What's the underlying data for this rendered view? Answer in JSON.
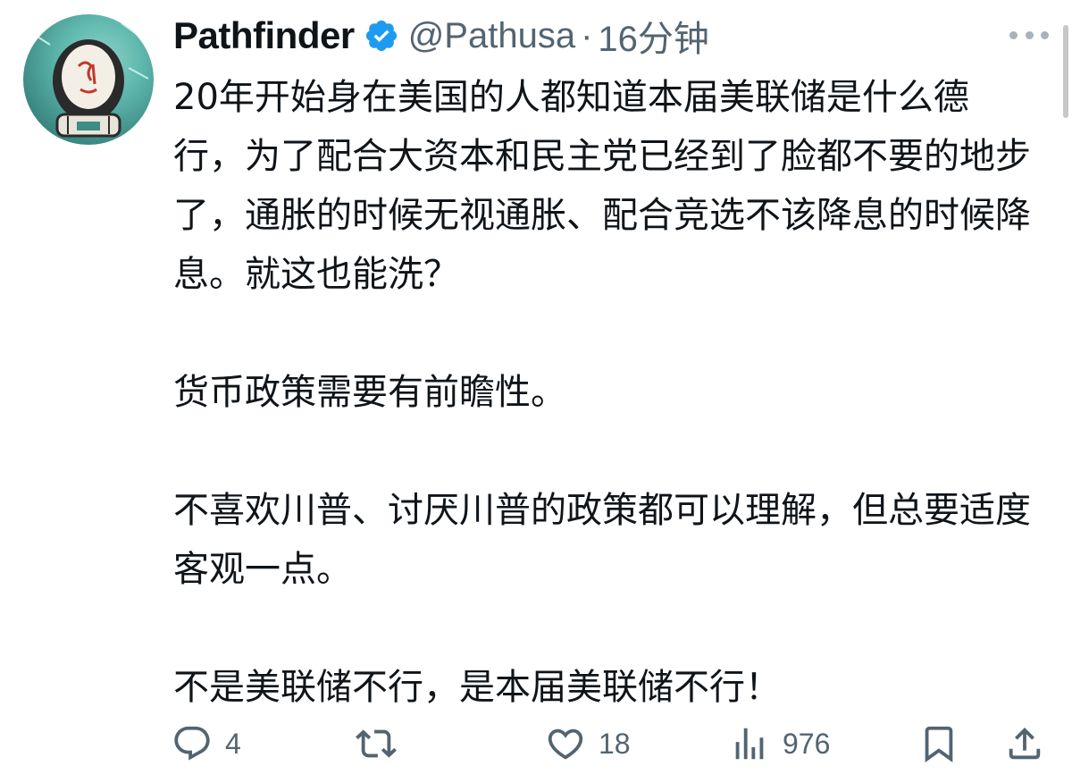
{
  "author": {
    "display_name": "Pathfinder",
    "handle": "@Pathusa",
    "separator": "·",
    "time_ago": "16分钟",
    "avatar_icon": "astronaut-avatar",
    "verified_icon": "verified-badge-icon",
    "verified_color": "#1d9bf0"
  },
  "tweet": {
    "paragraphs": [
      "20年开始身在美国的人都知道本届美联储是什么德行，为了配合大资本和民主党已经到了脸都不要的地步了，通胀的时候无视通胀、配合竞选不该降息的时候降息。就这也能洗？",
      "货币政策需要有前瞻性。",
      "不喜欢川普、讨厌川普的政策都可以理解，但总要适度客观一点。",
      "不是美联储不行，是本届美联储不行！"
    ]
  },
  "actions": {
    "reply": {
      "icon": "reply-icon",
      "count": "4"
    },
    "retweet": {
      "icon": "retweet-icon",
      "count": ""
    },
    "like": {
      "icon": "heart-icon",
      "count": "18"
    },
    "views": {
      "icon": "views-icon",
      "count": "976"
    },
    "bookmark": {
      "icon": "bookmark-icon"
    },
    "share": {
      "icon": "share-icon"
    }
  },
  "colors": {
    "text_primary": "#0f1419",
    "text_secondary": "#536471",
    "verified": "#1d9bf0"
  }
}
